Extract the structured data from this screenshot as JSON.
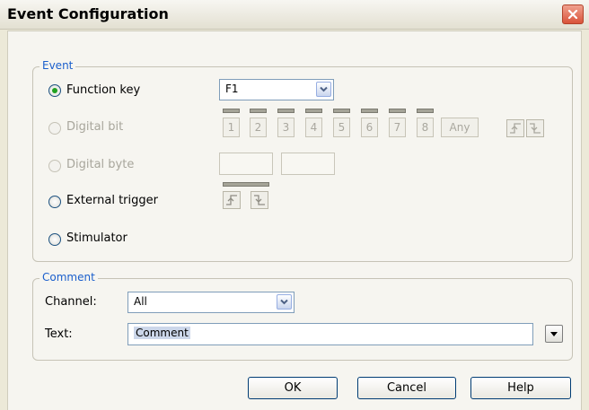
{
  "window": {
    "title": "Event Configuration"
  },
  "event_group": {
    "legend": "Event",
    "options": [
      {
        "label": "Function key",
        "selected": true,
        "enabled": true
      },
      {
        "label": "Digital bit",
        "selected": false,
        "enabled": false
      },
      {
        "label": "Digital byte",
        "selected": false,
        "enabled": false
      },
      {
        "label": "External trigger",
        "selected": false,
        "enabled": true
      },
      {
        "label": "Stimulator",
        "selected": false,
        "enabled": true
      }
    ],
    "function_key": {
      "value": "F1"
    },
    "digital_bits": {
      "labels": [
        "1",
        "2",
        "3",
        "4",
        "5",
        "6",
        "7",
        "8"
      ],
      "any_label": "Any"
    },
    "icons": {
      "rising_edge": "rising-edge-icon",
      "falling_edge": "falling-edge-icon",
      "dropdown": "chevron-down-icon",
      "close": "close-icon"
    }
  },
  "comment_group": {
    "legend": "Comment",
    "channel_label": "Channel:",
    "channel_value": "All",
    "text_label": "Text:",
    "text_value": "Comment"
  },
  "buttons": {
    "ok": "OK",
    "cancel": "Cancel",
    "help": "Help"
  },
  "colors": {
    "accent": "#1b5fcc",
    "close_button": "#d9533a"
  }
}
